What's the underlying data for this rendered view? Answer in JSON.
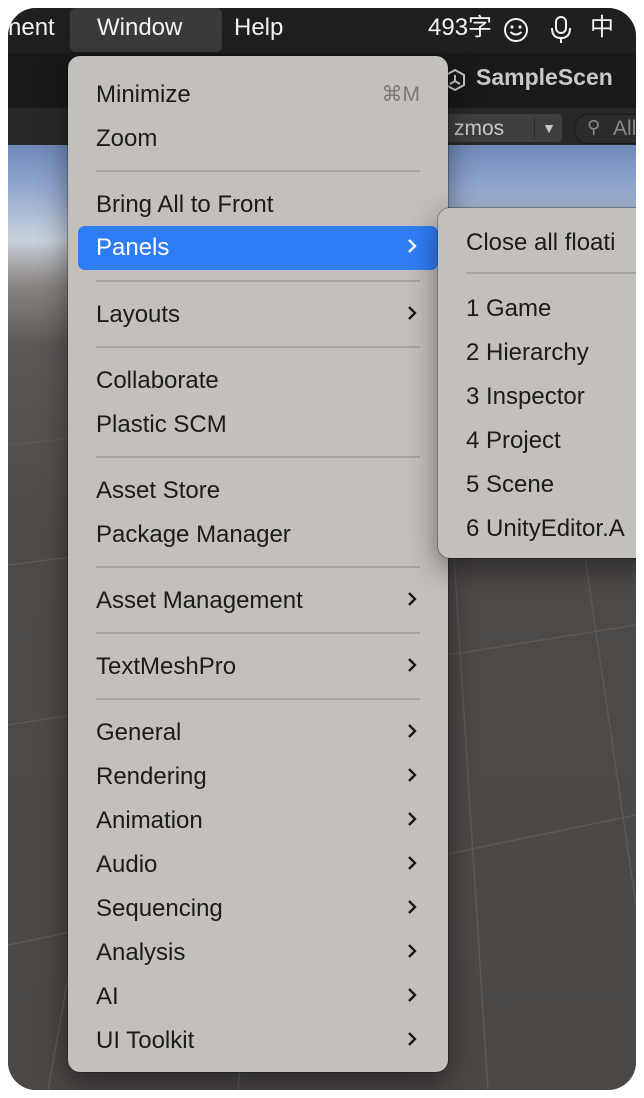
{
  "menubar": {
    "partial_left": "nent",
    "window": "Window",
    "help": "Help",
    "word_count": "493字",
    "ime": "中"
  },
  "unity": {
    "scene_title": "SampleScen",
    "gizmos": "zmos",
    "search_placeholder": "All"
  },
  "window_menu": {
    "minimize": "Minimize",
    "minimize_shortcut": "⌘M",
    "zoom": "Zoom",
    "bring_all": "Bring All to Front",
    "panels": "Panels",
    "layouts": "Layouts",
    "collaborate": "Collaborate",
    "plastic": "Plastic SCM",
    "asset_store": "Asset Store",
    "package_manager": "Package Manager",
    "asset_management": "Asset Management",
    "textmeshpro": "TextMeshPro",
    "general": "General",
    "rendering": "Rendering",
    "animation": "Animation",
    "audio": "Audio",
    "sequencing": "Sequencing",
    "analysis": "Analysis",
    "ai": "AI",
    "ui_toolkit": "UI Toolkit"
  },
  "panels_submenu": {
    "close_floating": "Close all floati",
    "items": [
      "1 Game",
      "2 Hierarchy",
      "3 Inspector",
      "4 Project",
      "5 Scene",
      "6 UnityEditor.A"
    ]
  },
  "colors": {
    "highlight": "#2f7df6",
    "menu_bg": "#c3bfbb",
    "menubar_bg": "#1f1f1f"
  },
  "icons": {
    "smiley": "smiley-icon",
    "mic": "microphone-icon",
    "chevron": "chevron-right-icon",
    "unity": "unity-logo-icon",
    "search": "search-icon"
  }
}
